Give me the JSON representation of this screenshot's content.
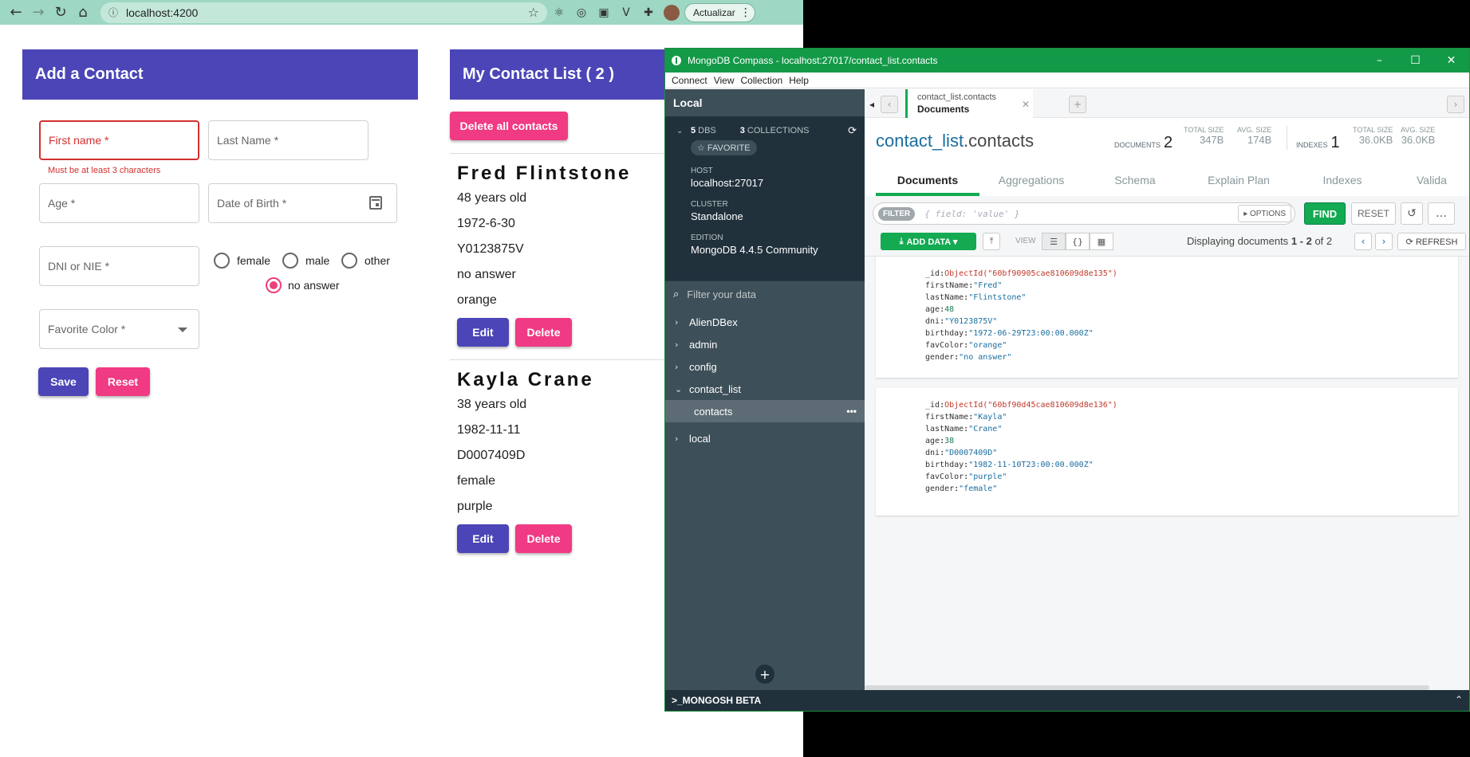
{
  "browser": {
    "url": "localhost:4200",
    "update_label": "Actualizar"
  },
  "form": {
    "title": "Add a Contact",
    "first_name": "First name *",
    "first_name_error": "Must be at least 3 characters",
    "last_name": "Last Name *",
    "age": "Age *",
    "dob": "Date of Birth *",
    "dni": "DNI or NIE *",
    "gender_options": [
      "female",
      "male",
      "other",
      "no answer"
    ],
    "gender_selected": "no answer",
    "favorite_color": "Favorite Color *",
    "save_label": "Save",
    "reset_label": "Reset"
  },
  "list": {
    "title": "My Contact List ( 2 )",
    "delete_all_label": "Delete all contacts",
    "edit_label": "Edit",
    "delete_label": "Delete",
    "contacts": [
      {
        "name": "Fred Flintstone",
        "age": "48 years old",
        "birthday": "1972-6-30",
        "dni": "Y0123875V",
        "gender": "no answer",
        "color": "orange"
      },
      {
        "name": "Kayla Crane",
        "age": "38 years old",
        "birthday": "1982-11-11",
        "dni": "D0007409D",
        "gender": "female",
        "color": "purple"
      }
    ]
  },
  "compass": {
    "window_title": "MongoDB Compass - localhost:27017/contact_list.contacts",
    "menu": [
      "Connect",
      "View",
      "Collection",
      "Help"
    ],
    "sidebar": {
      "title": "Local",
      "dbs_count": "5",
      "dbs_label": "DBS",
      "collections_count": "3",
      "collections_label": "COLLECTIONS",
      "favorite_label": "☆ FAVORITE",
      "host_label": "HOST",
      "host": "localhost:27017",
      "cluster_label": "CLUSTER",
      "cluster": "Standalone",
      "edition_label": "EDITION",
      "edition": "MongoDB 4.4.5 Community",
      "filter_placeholder": "Filter your data",
      "databases": [
        "AlienDBex",
        "admin",
        "config",
        "contact_list",
        "local"
      ],
      "expanded_db": "contact_list",
      "collections": [
        "contacts"
      ]
    },
    "tab": {
      "ns": "contact_list.contacts",
      "sub": "Documents"
    },
    "header": {
      "db": "contact_list",
      "coll": ".contacts",
      "documents_label": "DOCUMENTS",
      "documents_count": "2",
      "total_size_label": "TOTAL SIZE",
      "total_size": "347B",
      "avg_size_label": "AVG. SIZE",
      "avg_size": "174B",
      "indexes_label": "INDEXES",
      "indexes_count": "1",
      "idx_total_size": "36.0KB",
      "idx_avg_size": "36.0KB"
    },
    "subtabs": [
      "Documents",
      "Aggregations",
      "Schema",
      "Explain Plan",
      "Indexes",
      "Valida"
    ],
    "query": {
      "filter_label": "FILTER",
      "placeholder": "{ field: 'value' }",
      "options_label": "▸ OPTIONS",
      "find_label": "FIND",
      "reset_label": "RESET"
    },
    "crud": {
      "add_data_label": "ADD DATA ▾",
      "view_label": "VIEW",
      "displaying_prefix": "Displaying documents",
      "range": "1 - 2",
      "of_label": "of 2",
      "refresh_label": "⟳ REFRESH"
    },
    "documents": [
      [
        {
          "k": "_id",
          "v": "ObjectId(\"60bf90905cae810609d8e135\")",
          "t": "oid"
        },
        {
          "k": "firstName",
          "v": "\"Fred\"",
          "t": "str"
        },
        {
          "k": "lastName",
          "v": "\"Flintstone\"",
          "t": "str"
        },
        {
          "k": "age",
          "v": "48",
          "t": "num"
        },
        {
          "k": "dni",
          "v": "\"Y0123875V\"",
          "t": "str"
        },
        {
          "k": "birthday",
          "v": "\"1972-06-29T23:00:00.000Z\"",
          "t": "str"
        },
        {
          "k": "favColor",
          "v": "\"orange\"",
          "t": "str"
        },
        {
          "k": "gender",
          "v": "\"no answer\"",
          "t": "str"
        }
      ],
      [
        {
          "k": "_id",
          "v": "ObjectId(\"60bf90d45cae810609d8e136\")",
          "t": "oid"
        },
        {
          "k": "firstName",
          "v": "\"Kayla\"",
          "t": "str"
        },
        {
          "k": "lastName",
          "v": "\"Crane\"",
          "t": "str"
        },
        {
          "k": "age",
          "v": "38",
          "t": "num"
        },
        {
          "k": "dni",
          "v": "\"D0007409D\"",
          "t": "str"
        },
        {
          "k": "birthday",
          "v": "\"1982-11-10T23:00:00.000Z\"",
          "t": "str"
        },
        {
          "k": "favColor",
          "v": "\"purple\"",
          "t": "str"
        },
        {
          "k": "gender",
          "v": "\"female\"",
          "t": "str"
        }
      ]
    ],
    "mongosh_label": ">_MONGOSH BETA"
  },
  "colors": {
    "primary": "#4b45b7",
    "accent": "#f03a83",
    "mongo_green": "#13aa52",
    "sidebar_bg": "#3d4f58"
  }
}
